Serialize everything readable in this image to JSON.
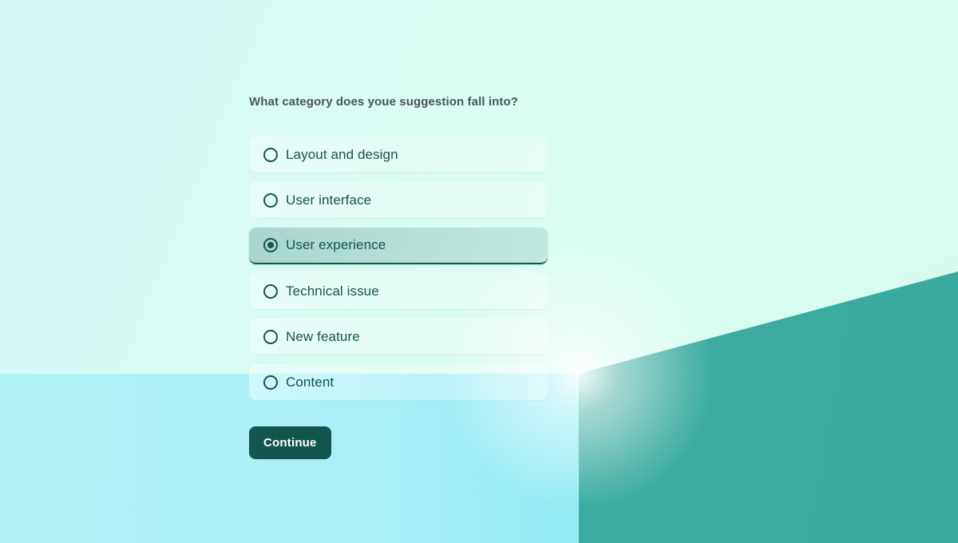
{
  "form": {
    "question": "What category does youe suggestion fall into?",
    "options": [
      {
        "label": "Layout and design",
        "selected": false
      },
      {
        "label": "User interface",
        "selected": false
      },
      {
        "label": "User experience",
        "selected": true
      },
      {
        "label": "Technical issue",
        "selected": false
      },
      {
        "label": "New feature",
        "selected": false
      },
      {
        "label": "Content",
        "selected": false
      }
    ],
    "submit_label": "Continue"
  },
  "theme": {
    "accent_dark_teal": "#13564d",
    "wedge_teal": "#3aaa9d",
    "background_cyan": "#a8f0f6",
    "background_mint": "#d8fdee",
    "title_color": "#4b555f"
  }
}
